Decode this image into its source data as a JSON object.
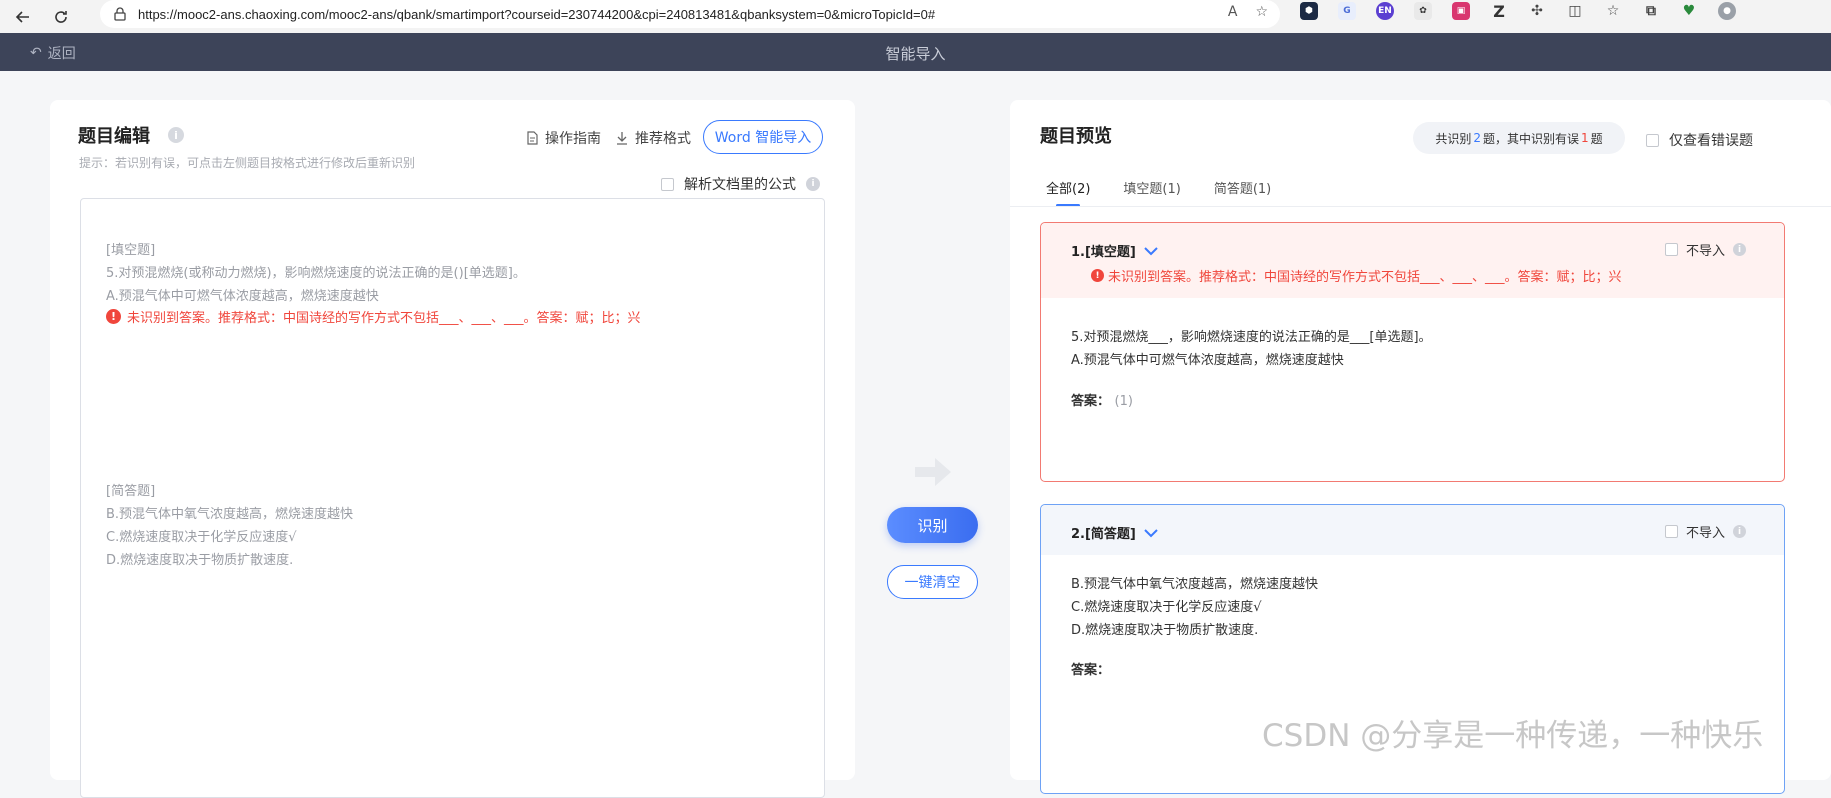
{
  "browser": {
    "url": "https://mooc2-ans.chaoxing.com/mooc2-ans/qbank/smartimport?courseid=230744200&cpi=240813481&qbanksystem=0&microTopicId=0#"
  },
  "header": {
    "back_label": "返回",
    "title": "智能导入"
  },
  "editor_panel": {
    "title": "题目编辑",
    "hint": "提示：若识别有误，可点击左侧题目按格式进行修改后重新识别",
    "guide_label": "操作指南",
    "format_label": "推荐格式",
    "word_import_label": "Word 智能导入",
    "parse_formula_label": "解析文档里的公式",
    "lines_block1": [
      "[填空题]",
      "5.对预混燃烧(或称动力燃烧)，影响燃烧速度的说法正确的是()[单选题]。",
      "A.预混气体中可燃气体浓度越高，燃烧速度越快"
    ],
    "error_text": "未识别到答案。推荐格式：中国诗经的写作方式不包括___、___、___。答案：赋；比；兴",
    "lines_block2": [
      "[简答题]",
      "B.预混气体中氧气浓度越高，燃烧速度越快",
      "C.燃烧速度取决于化学反应速度√",
      "D.燃烧速度取决于物质扩散速度."
    ]
  },
  "actions": {
    "identify_label": "识别",
    "clear_label": "一键清空"
  },
  "preview_panel": {
    "title": "题目预览",
    "summary_prefix": "共识别",
    "summary_total": "2",
    "summary_mid": "题，其中识别有误",
    "summary_errors": "1",
    "summary_suffix": "题",
    "only_errors_label": "仅查看错误题",
    "tabs": [
      {
        "label": "全部(2)"
      },
      {
        "label": "填空题(1)"
      },
      {
        "label": "简答题(1)"
      }
    ],
    "questions": [
      {
        "type_label": "1.[填空题]",
        "no_import_label": "不导入",
        "error_text": "未识别到答案。推荐格式：中国诗经的写作方式不包括___、___、___。答案：赋；比；兴",
        "lines": [
          "5.对预混燃烧___，影响燃烧速度的说法正确的是___[单选题]。",
          "A.预混气体中可燃气体浓度越高，燃烧速度越快"
        ],
        "answer_label": "答案：",
        "answer_value": "(1)"
      },
      {
        "type_label": "2.[简答题]",
        "no_import_label": "不导入",
        "lines": [
          "B.预混气体中氧气浓度越高，燃烧速度越快",
          "C.燃烧速度取决于化学反应速度√",
          "D.燃烧速度取决于物质扩散速度."
        ],
        "answer_label": "答案："
      }
    ]
  },
  "watermark": "CSDN @分享是一种传递，一种快乐"
}
